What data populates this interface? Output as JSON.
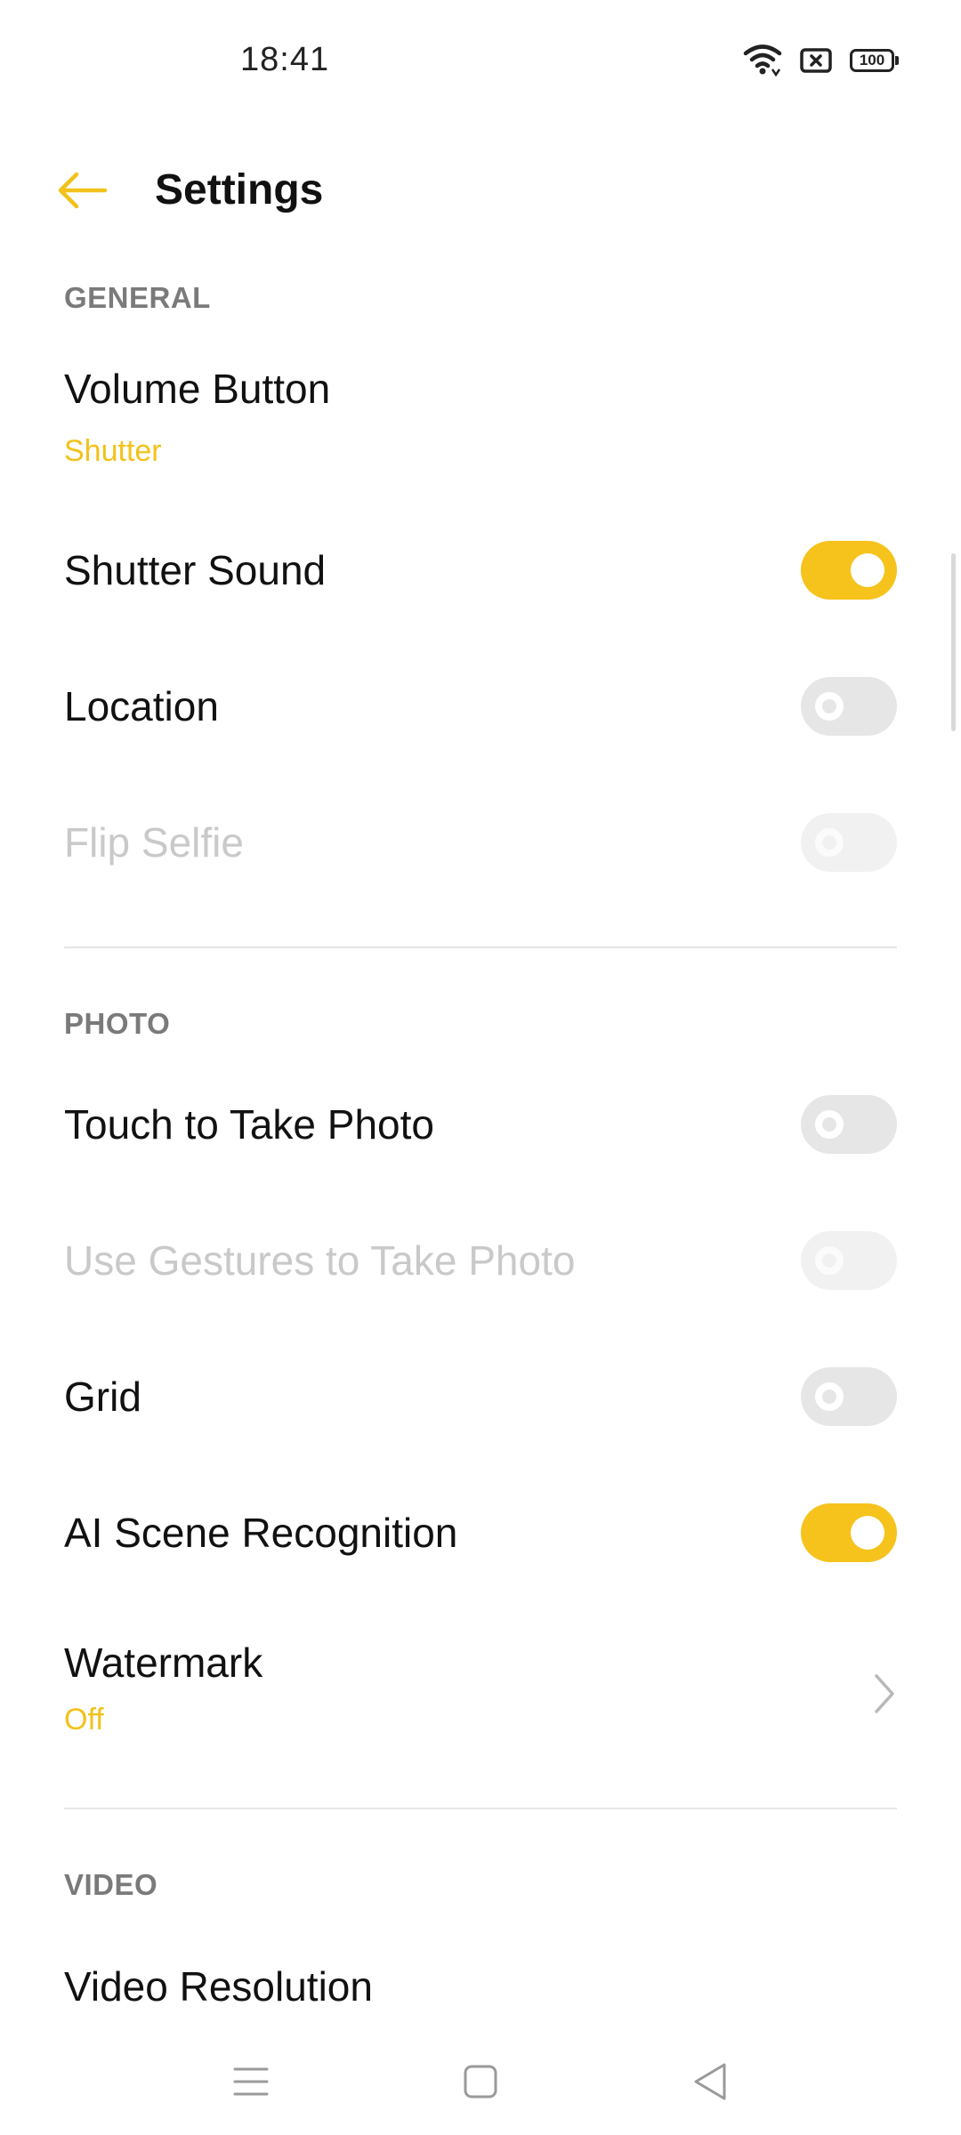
{
  "status_bar": {
    "time": "18:41",
    "battery": "100",
    "icons": [
      "wifi-icon",
      "no-sim-icon",
      "battery-icon"
    ]
  },
  "header": {
    "title": "Settings",
    "back_icon": "arrow-left-icon"
  },
  "colors": {
    "accent": "#f6c21c",
    "subtitle": "#f2c21b",
    "section_header": "#7a7a7a",
    "disabled_text": "#c9c9c9"
  },
  "sections": {
    "general": {
      "title": "GENERAL",
      "volume_button": {
        "label": "Volume Button",
        "value": "Shutter"
      },
      "shutter_sound": {
        "label": "Shutter Sound",
        "enabled": true
      },
      "location": {
        "label": "Location",
        "enabled": false
      },
      "flip_selfie": {
        "label": "Flip Selfie",
        "enabled": false,
        "disabled": true
      }
    },
    "photo": {
      "title": "PHOTO",
      "touch_to_take_photo": {
        "label": "Touch to Take Photo",
        "enabled": false
      },
      "use_gestures": {
        "label": "Use Gestures to Take Photo",
        "enabled": false,
        "disabled": true
      },
      "grid": {
        "label": "Grid",
        "enabled": false
      },
      "ai_scene": {
        "label": "AI Scene Recognition",
        "enabled": true
      },
      "watermark": {
        "label": "Watermark",
        "value": "Off"
      }
    },
    "video": {
      "title": "VIDEO",
      "video_resolution": {
        "label": "Video Resolution"
      }
    }
  },
  "nav_bar": {
    "icons": [
      "menu-icon",
      "home-icon",
      "back-triangle-icon"
    ]
  }
}
